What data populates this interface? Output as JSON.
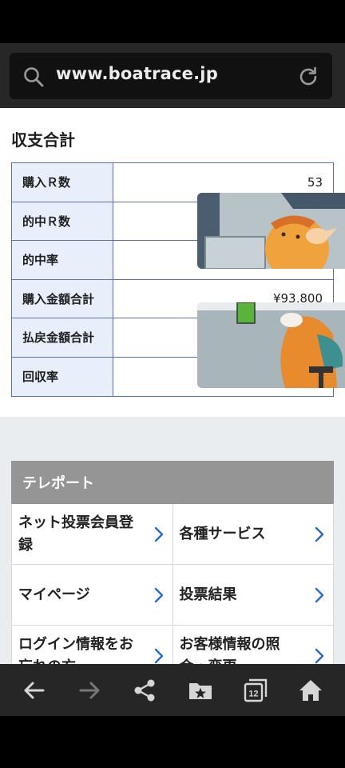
{
  "browser": {
    "url": "www.boatrace.jp",
    "tab_count": "12"
  },
  "page": {
    "section_title": "収支合計",
    "stats": [
      {
        "label": "購入Ｒ数",
        "value": "53"
      },
      {
        "label": "的中Ｒ数",
        "value": ""
      },
      {
        "label": "的中率",
        "value": ""
      },
      {
        "label": "購入金額合計",
        "value": "¥93,800"
      },
      {
        "label": "払戻金額合計",
        "value": ""
      },
      {
        "label": "回収率",
        "value": ""
      }
    ],
    "teleport": {
      "header": "テレポート",
      "links": [
        "ネット投票会員登録",
        "各種サービス",
        "マイページ",
        "投票結果",
        "ログイン情報をお忘れの方",
        "お客様情報の照会・変更"
      ]
    }
  },
  "colors": {
    "table_border": "#5573b6",
    "label_bg": "#e8effb",
    "chevron": "#2a6bc4",
    "teleport_header": "#959595"
  }
}
